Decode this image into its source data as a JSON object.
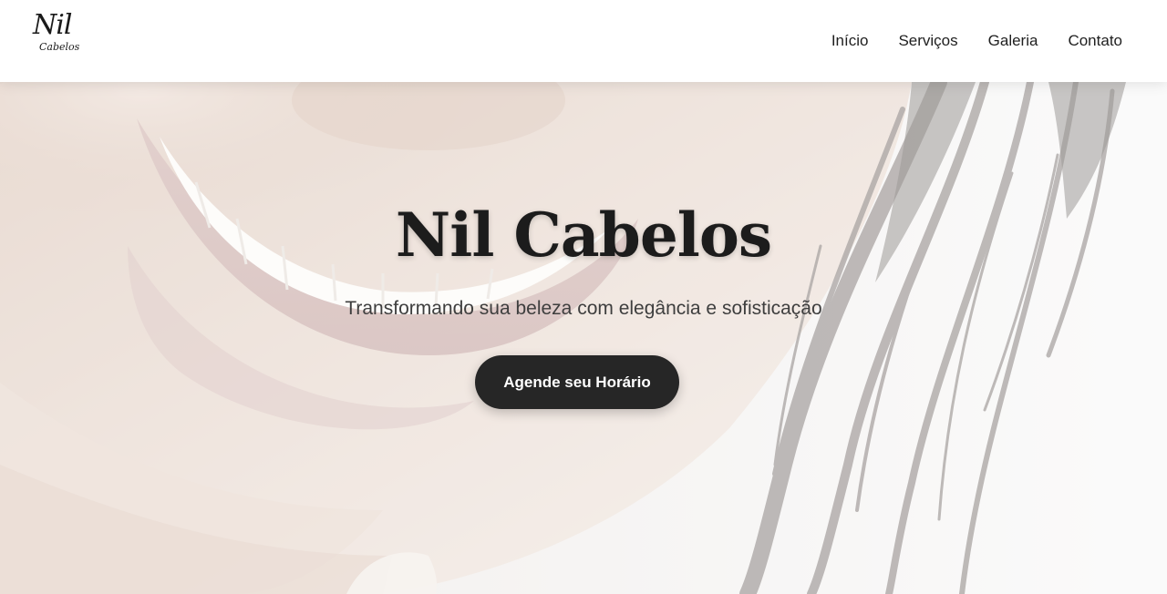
{
  "brand": {
    "logo_line1": "Nil",
    "logo_line2": "Cabelos"
  },
  "nav": {
    "items": [
      {
        "label": "Início"
      },
      {
        "label": "Serviços"
      },
      {
        "label": "Galeria"
      },
      {
        "label": "Contato"
      }
    ]
  },
  "hero": {
    "title": "Nil Cabelos",
    "subtitle": "Transformando sua beleza com elegância e sofisticação",
    "cta_label": "Agende seu Horário"
  },
  "colors": {
    "header_bg": "#ffffff",
    "button_bg": "#262626",
    "button_text": "#ffffff",
    "title_text": "#1c1c1c",
    "nav_text": "#1f1f1f"
  }
}
